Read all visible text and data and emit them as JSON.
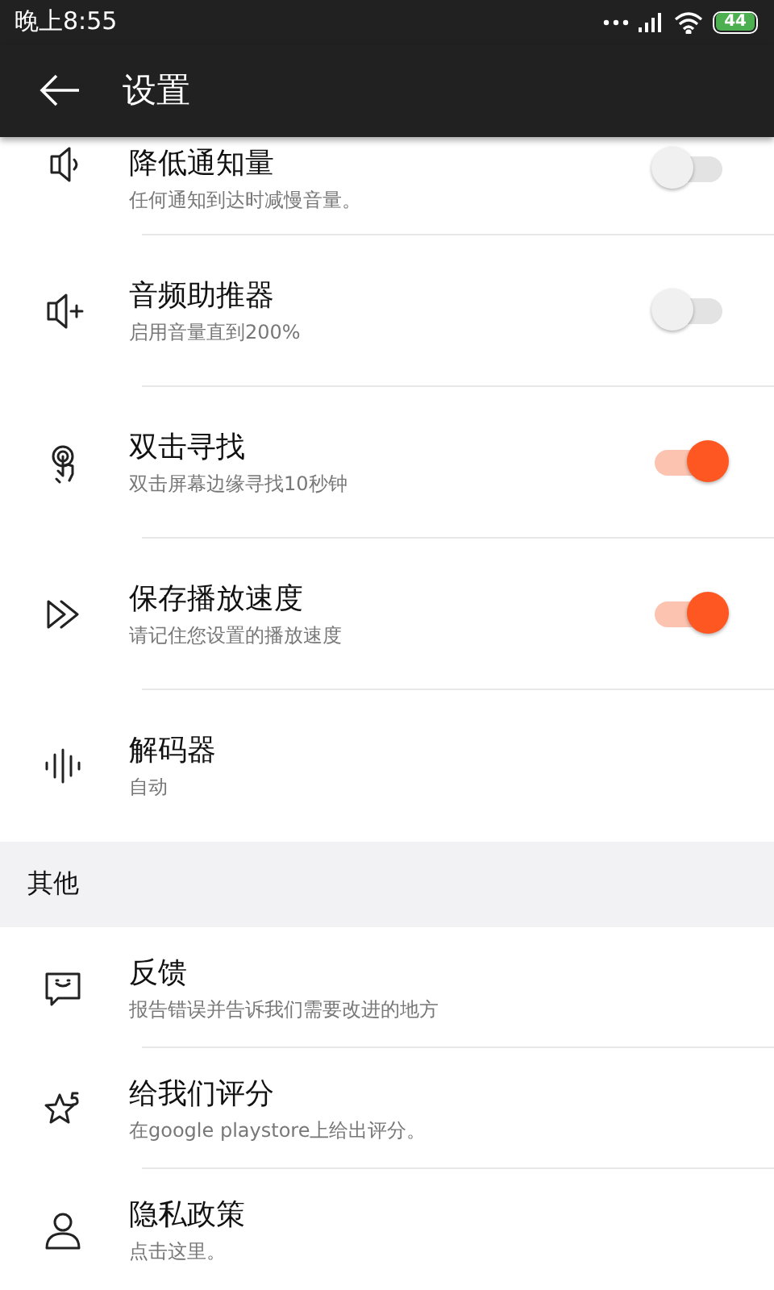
{
  "status_bar": {
    "time": "晚上8:55",
    "battery": "44"
  },
  "app_bar": {
    "title": "设置"
  },
  "sections": [
    {
      "items": [
        {
          "title": "降低通知量",
          "subtitle": "任何通知到达时减慢音量。",
          "kind": "toggle",
          "on": false
        },
        {
          "title": "音频助推器",
          "subtitle": "启用音量直到200%",
          "kind": "toggle",
          "on": false
        },
        {
          "title": "双击寻找",
          "subtitle": "双击屏幕边缘寻找10秒钟",
          "kind": "toggle",
          "on": true
        },
        {
          "title": "保存播放速度",
          "subtitle": "请记住您设置的播放速度",
          "kind": "toggle",
          "on": true
        },
        {
          "title": "解码器",
          "subtitle": "自动",
          "kind": "plain"
        }
      ]
    },
    {
      "header": "其他",
      "items": [
        {
          "title": "反馈",
          "subtitle": "报告错误并告诉我们需要改进的地方",
          "kind": "plain"
        },
        {
          "title": "给我们评分",
          "subtitle": "在google playstore上给出评分。",
          "kind": "plain"
        },
        {
          "title": "隐私政策",
          "subtitle": "点击这里。",
          "kind": "plain"
        }
      ]
    }
  ]
}
